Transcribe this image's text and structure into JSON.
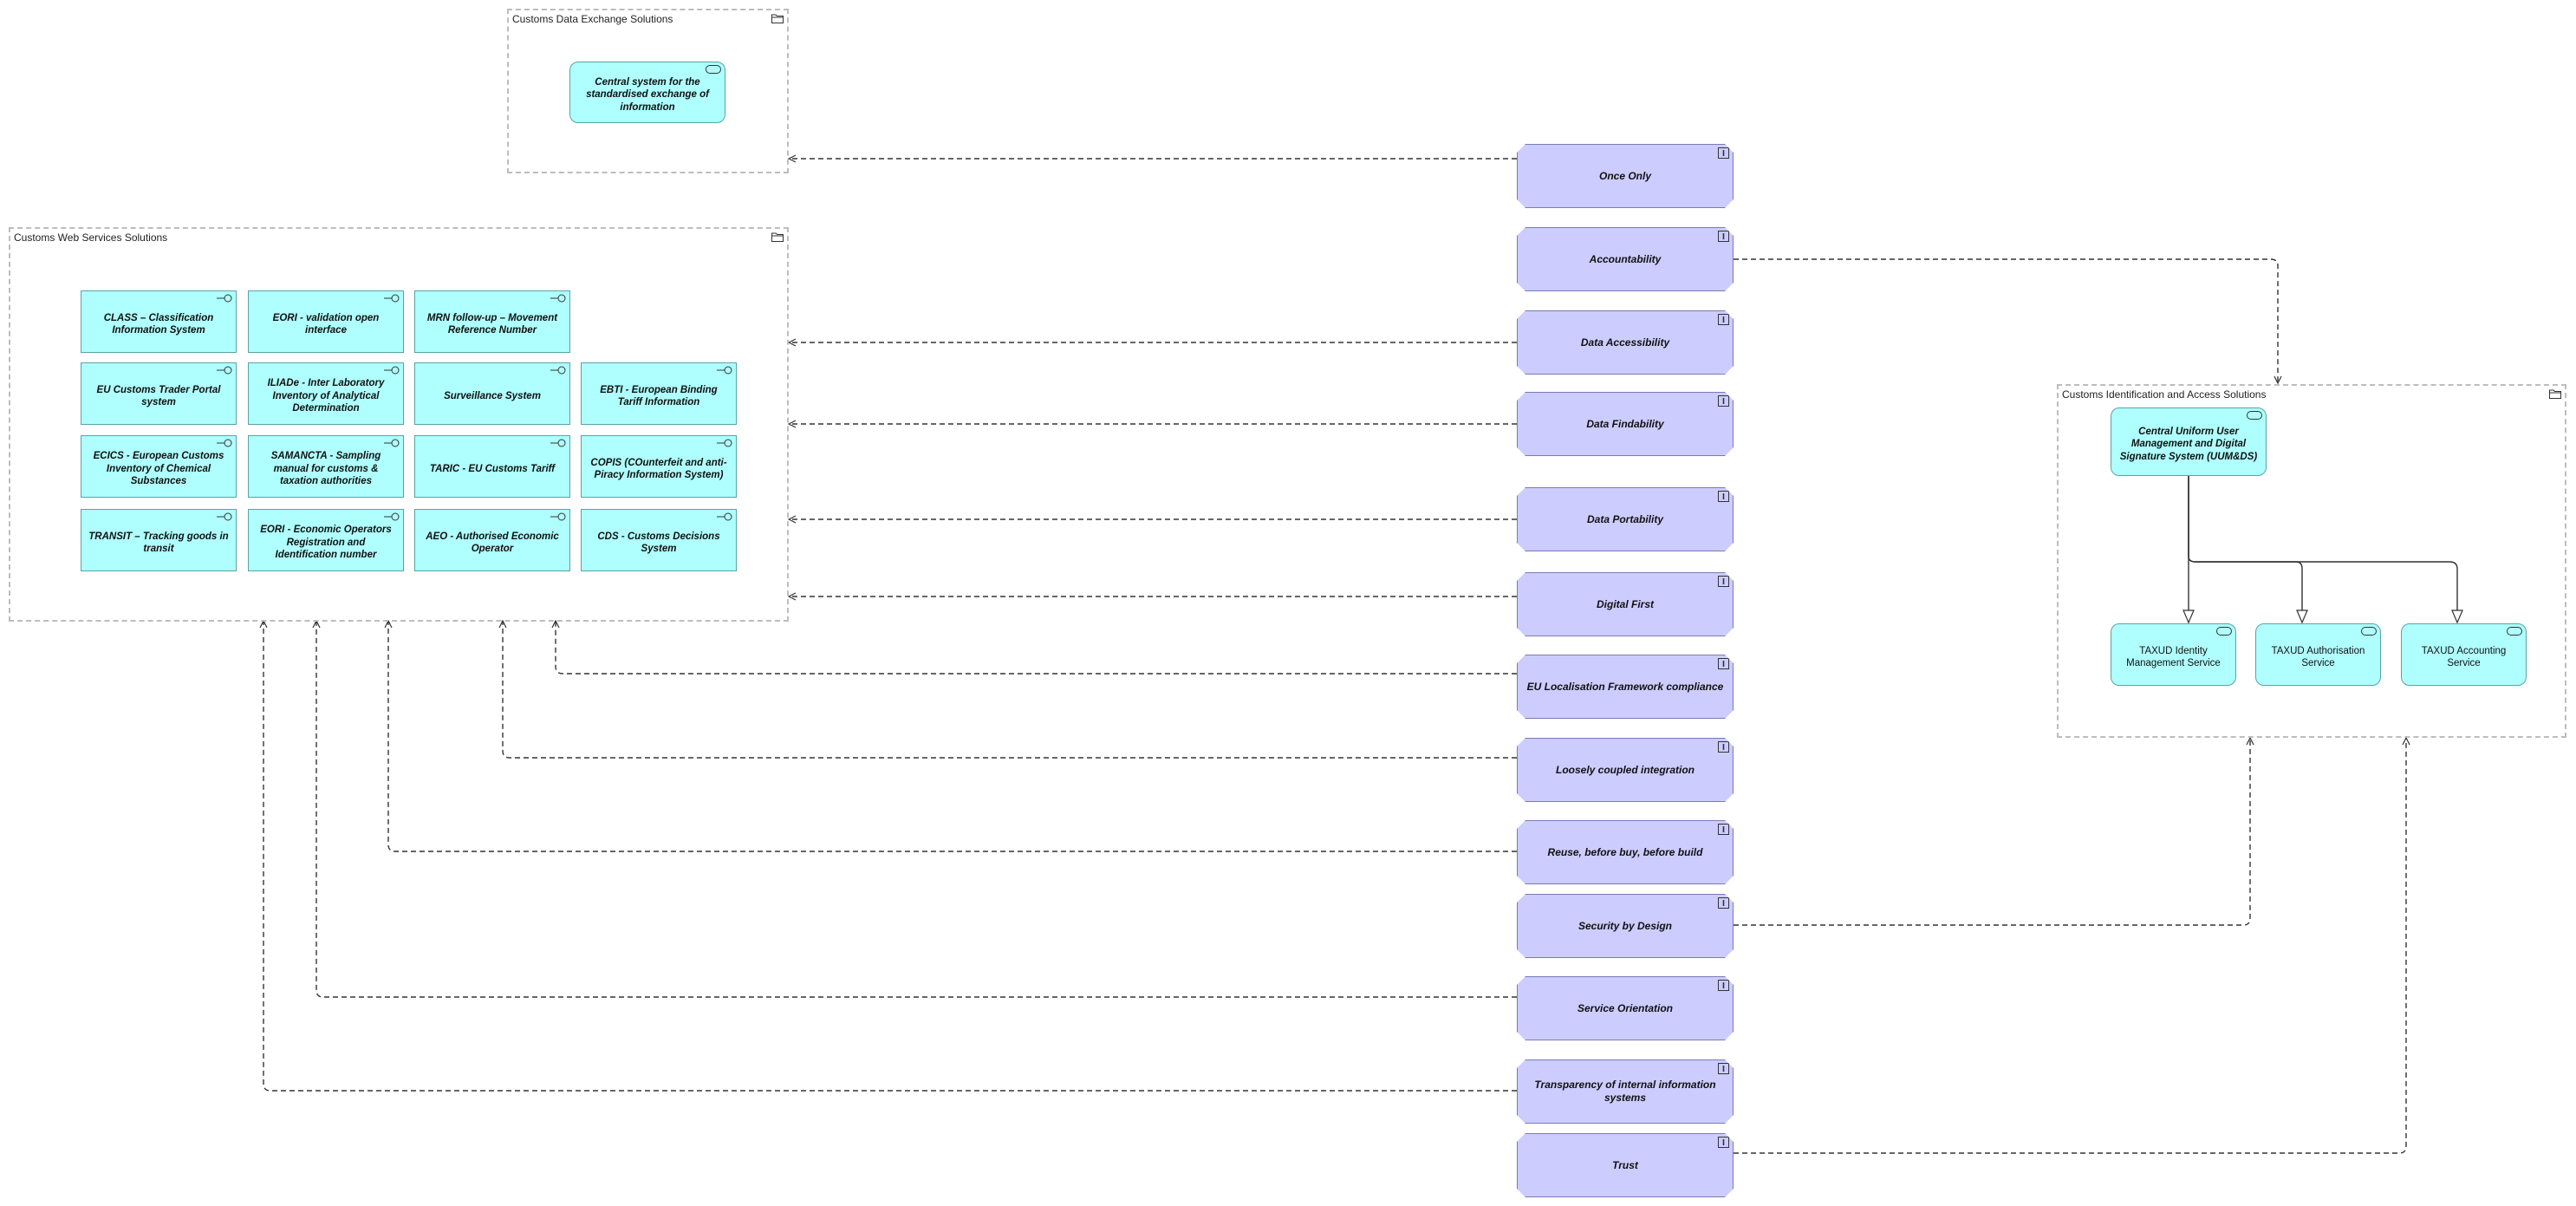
{
  "colors": {
    "application_fill": "#afffff",
    "principle_fill": "#ccccff",
    "group_border": "#bdbdbd",
    "connector": "#333333"
  },
  "groups": {
    "data_exchange": {
      "title": "Customs Data Exchange Solutions"
    },
    "web_services": {
      "title": "Customs Web Services Solutions"
    },
    "identification": {
      "title": "Customs Identification and Access Solutions"
    }
  },
  "applications": [
    {
      "id": "class",
      "label": "CLASS – Classification Information System"
    },
    {
      "id": "eori_validation",
      "label": "EORI - validation open interface"
    },
    {
      "id": "mrn",
      "label": "MRN follow-up – Movement Reference Number"
    },
    {
      "id": "trader_portal",
      "label": "EU Customs Trader Portal system"
    },
    {
      "id": "iliade",
      "label": "ILIADe - Inter Laboratory Inventory of Analytical Determination"
    },
    {
      "id": "surveillance",
      "label": "Surveillance System"
    },
    {
      "id": "ebti",
      "label": "EBTI - European Binding Tariff Information"
    },
    {
      "id": "ecics",
      "label": "ECICS - European Customs Inventory of Chemical Substances"
    },
    {
      "id": "samancta",
      "label": "SAMANCTA - Sampling manual for customs & taxation authorities"
    },
    {
      "id": "taric",
      "label": "TARIC - EU Customs Tariff"
    },
    {
      "id": "copis",
      "label": "COPIS (COunterfeit and anti-Piracy Information System)"
    },
    {
      "id": "transit",
      "label": "TRANSIT – Tracking goods in transit"
    },
    {
      "id": "eori_registration",
      "label": "EORI - Economic Operators Registration and Identification number"
    },
    {
      "id": "aeo",
      "label": "AEO - Authorised Economic Operator"
    },
    {
      "id": "cds",
      "label": "CDS - Customs Decisions System"
    }
  ],
  "services": [
    {
      "id": "central_exchange",
      "label": "Central system for the standardised exchange of information"
    },
    {
      "id": "uum",
      "label": "Central Uniform User Management and Digital Signature System (UUM&DS)"
    },
    {
      "id": "identity",
      "label": "TAXUD Identity Management Service"
    },
    {
      "id": "authorisation",
      "label": "TAXUD Authorisation Service"
    },
    {
      "id": "accounting",
      "label": "TAXUD Accounting Service"
    }
  ],
  "principles": [
    {
      "id": "once_only",
      "label": "Once Only"
    },
    {
      "id": "accountability",
      "label": "Accountability"
    },
    {
      "id": "data_accessibility",
      "label": "Data Accessibility"
    },
    {
      "id": "data_findability",
      "label": "Data Findability"
    },
    {
      "id": "data_portability",
      "label": "Data Portability"
    },
    {
      "id": "digital_first",
      "label": "Digital First"
    },
    {
      "id": "eu_localisation",
      "label": "EU Localisation Framework compliance"
    },
    {
      "id": "loosely_coupled",
      "label": "Loosely coupled integration"
    },
    {
      "id": "reuse",
      "label": "Reuse, before buy, before build"
    },
    {
      "id": "security",
      "label": "Security by Design"
    },
    {
      "id": "service_orientation",
      "label": "Service Orientation"
    },
    {
      "id": "transparency",
      "label": "Transparency of internal information systems"
    },
    {
      "id": "trust",
      "label": "Trust"
    }
  ]
}
